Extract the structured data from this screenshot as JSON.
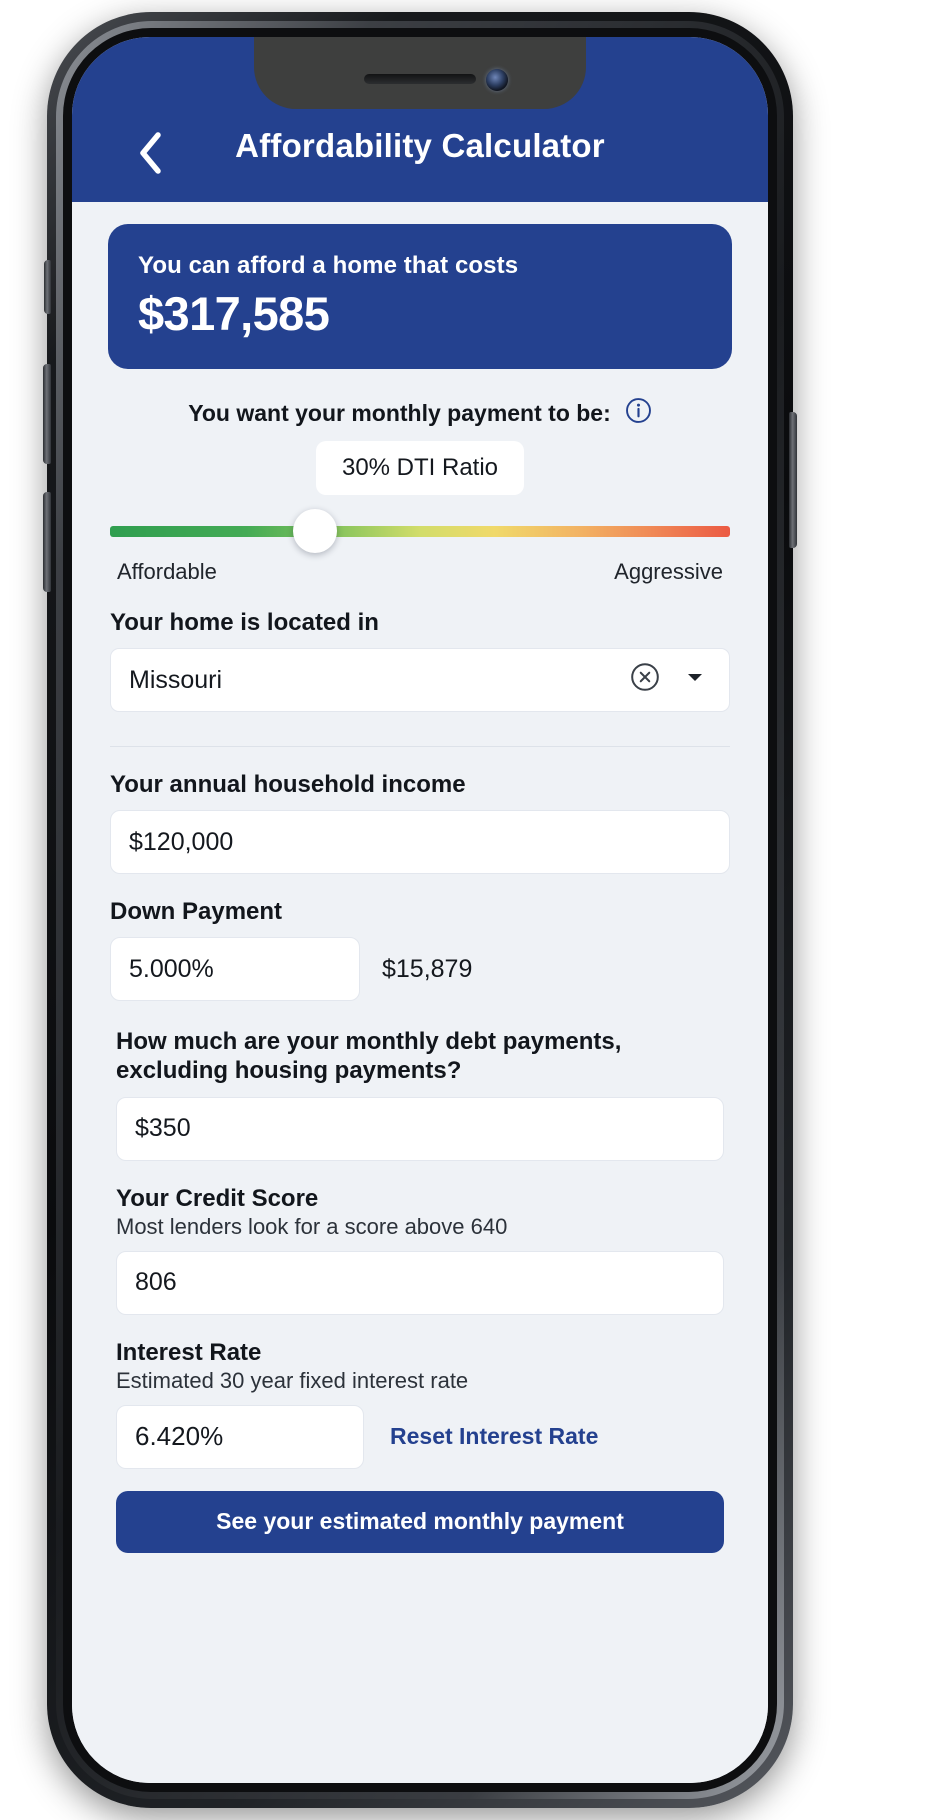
{
  "header": {
    "title": "Affordability Calculator",
    "back_icon": "chevron-left-icon",
    "brand_color": "#24418f"
  },
  "hero": {
    "label": "You can afford a home that costs",
    "amount": "$317,585"
  },
  "dti": {
    "question": "You want your monthly payment to be:",
    "info_icon": "info-circle-icon",
    "badge": "30% DTI Ratio",
    "slider_position_percent": 33,
    "left_label": "Affordable",
    "right_label": "Aggressive",
    "gradient_start": "#2f9e4f",
    "gradient_mid": "#f0d96a",
    "gradient_end": "#eb5a43"
  },
  "location": {
    "label": "Your home is located in",
    "value": "Missouri",
    "clear_icon": "clear-circle-icon",
    "chevron_icon": "chevron-down-icon"
  },
  "income": {
    "label": "Your annual household income",
    "value": "$120,000"
  },
  "down_payment": {
    "label": "Down Payment",
    "percent": "5.000%",
    "amount": "$15,879"
  },
  "debt": {
    "question_line1": "How much are your monthly debt payments,",
    "question_line2": "excluding housing payments?",
    "value": "$350"
  },
  "credit_score": {
    "label": "Your Credit Score",
    "sub": "Most lenders look for a score above 640",
    "value": "806"
  },
  "interest_rate": {
    "label": "Interest Rate",
    "sub": "Estimated 30 year fixed interest rate",
    "value": "6.420%",
    "reset_label": "Reset Interest Rate",
    "link_color": "#24418f"
  },
  "cta": {
    "label": "See your estimated monthly payment"
  }
}
